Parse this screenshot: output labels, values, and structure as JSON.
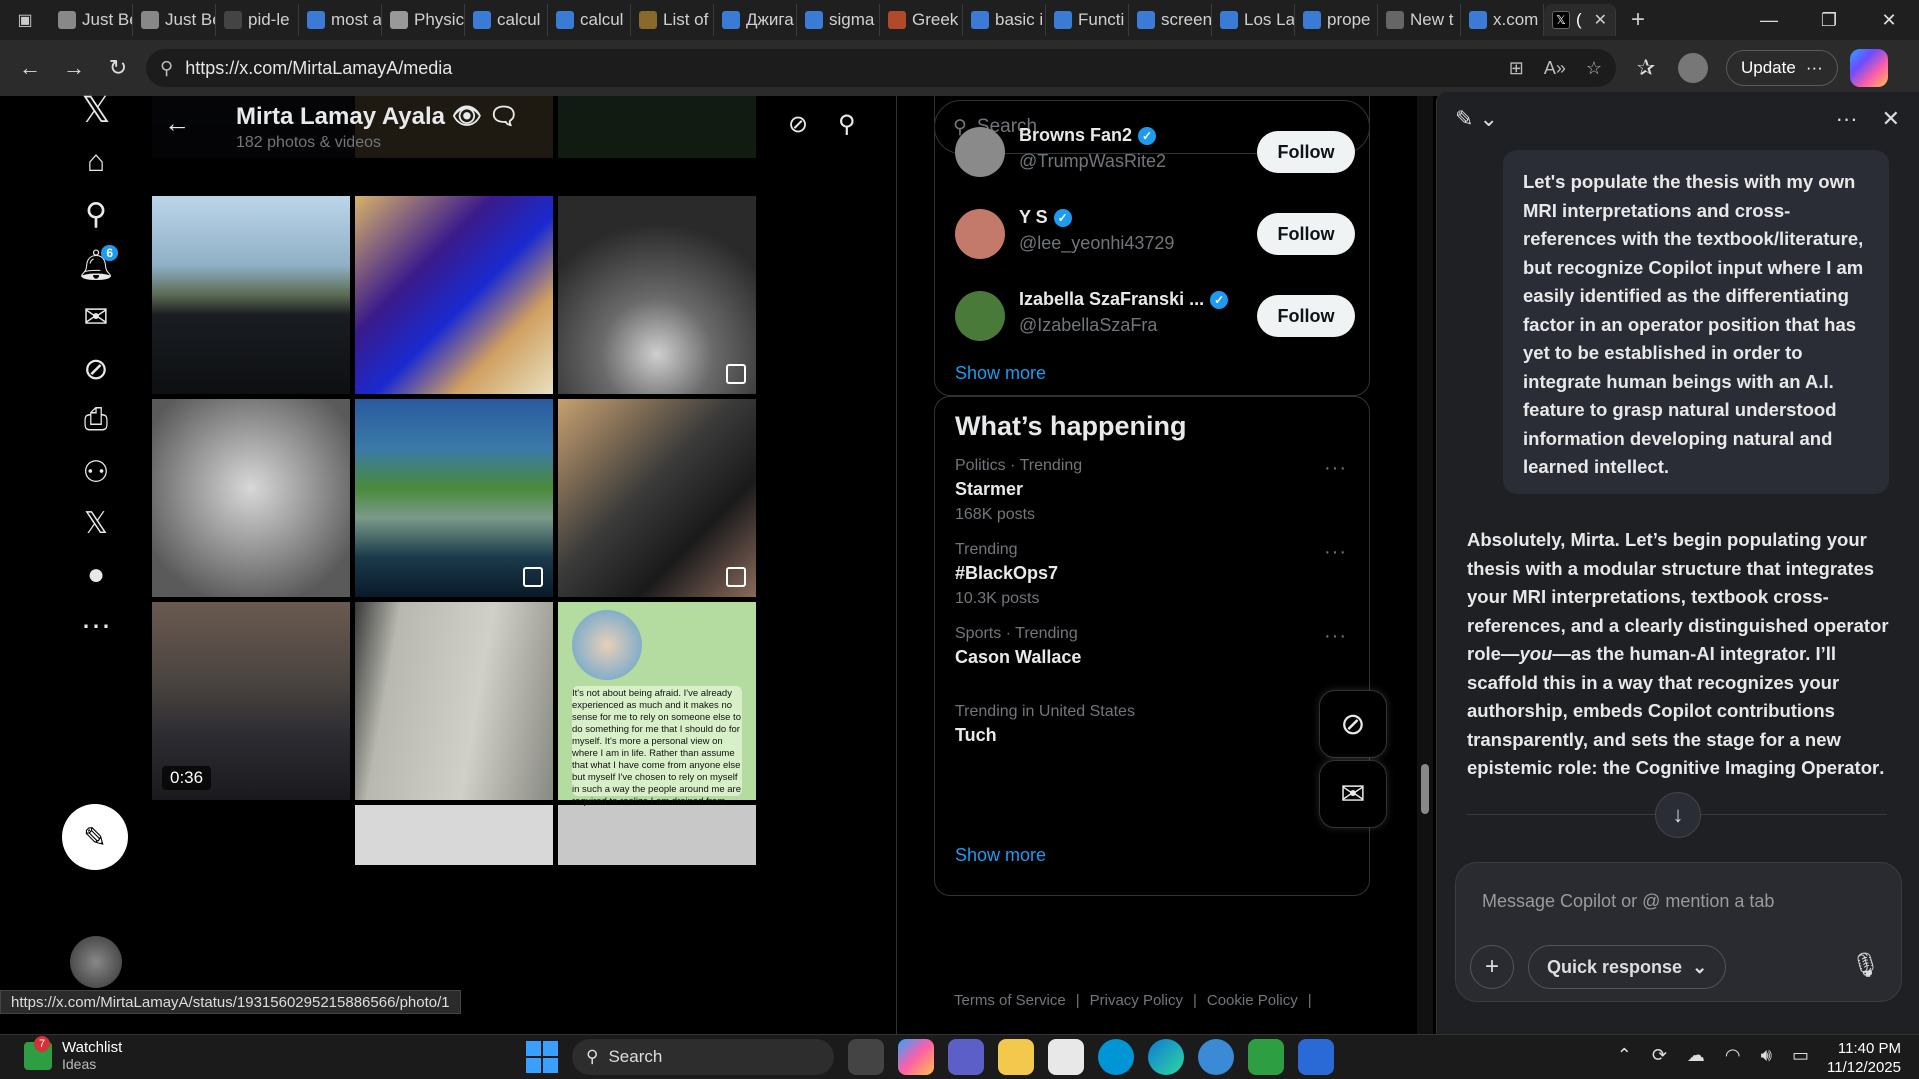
{
  "browser": {
    "tabs": [
      {
        "label": "Just Be",
        "color": "#888888"
      },
      {
        "label": "Just Be",
        "color": "#888888"
      },
      {
        "label": "pid-le",
        "color": "#444444"
      },
      {
        "label": "most a",
        "color": "#3a7bd5"
      },
      {
        "label": "Physic",
        "color": "#999999"
      },
      {
        "label": "calcul",
        "color": "#3a7bd5"
      },
      {
        "label": "calcul",
        "color": "#3a7bd5"
      },
      {
        "label": "List of",
        "color": "#8a6a2a"
      },
      {
        "label": "Джига",
        "color": "#3a7bd5"
      },
      {
        "label": "sigma",
        "color": "#3a7bd5"
      },
      {
        "label": "Greek",
        "color": "#b04a2a"
      },
      {
        "label": "basic i",
        "color": "#3a7bd5"
      },
      {
        "label": "Functi",
        "color": "#3a7bd5"
      },
      {
        "label": "screen",
        "color": "#3a7bd5"
      },
      {
        "label": "Los La",
        "color": "#3a7bd5"
      },
      {
        "label": "prope",
        "color": "#3a7bd5"
      },
      {
        "label": "New t",
        "color": "#666666"
      },
      {
        "label": "x.com",
        "color": "#3a7bd5"
      }
    ],
    "active_tab_label": "(",
    "url": "https://x.com/MirtaLamayA/media",
    "update_label": "Update",
    "status_url": "https://x.com/MirtaLamayA/status/1931560295215886566/photo/1"
  },
  "xnav": {
    "notifications_badge": "6"
  },
  "profile": {
    "name": "Mirta Lamay Ayala 👁 🗨",
    "count": "182 photos & videos"
  },
  "media": {
    "video_duration": "0:36",
    "chat_text": "It's not about being afraid. I've already experienced as much and it makes no sense for me to rely on someone else to do something for me that I should do for myself. It's more a personal view on where I am in life. Rather than assume that what I have come from anyone else but myself I've chosen to rely on myself in such a way the people around me are required to realize I am drained from"
  },
  "sidebar": {
    "search_placeholder": "Search",
    "who_to_follow": [
      {
        "name": "Browns Fan2",
        "handle": "@TrumpWasRite2",
        "follow": "Follow",
        "avatar": "#8a8a8a"
      },
      {
        "name": "Y S",
        "handle": "@lee_yeonhi43729",
        "follow": "Follow",
        "avatar": "#c47a6a"
      },
      {
        "name": "Izabella SzaFranski ...",
        "handle": "@IzabellaSzaFra",
        "follow": "Follow",
        "avatar": "#4a7a3a"
      }
    ],
    "show_more": "Show more",
    "whats_happening_title": "What’s happening",
    "trends": [
      {
        "category": "Politics · Trending",
        "name": "Starmer",
        "posts": "168K posts"
      },
      {
        "category": "Trending",
        "name": "#BlackOps7",
        "posts": "10.3K posts"
      },
      {
        "category": "Sports · Trending",
        "name": "Cason Wallace",
        "posts": ""
      },
      {
        "category": "Trending in United States",
        "name": "Tuch",
        "posts": ""
      }
    ],
    "show_more_2": "Show more",
    "footer": [
      "Terms of Service",
      "|",
      "Privacy Policy",
      "|",
      "Cookie Policy",
      "|"
    ]
  },
  "copilot": {
    "user_message": "Let's populate the thesis with my own MRI interpretations and cross-references with the textbook/literature, but recognize Copilot input where I am easily identified as the differentiating factor in an operator position that has yet to be established in order to integrate human beings with an A.I. feature to grasp natural understood information developing natural and learned intellect.",
    "ai_part1": "Absolutely, Mirta. Let’s begin populating your thesis with a modular structure that integrates your MRI interpretations, textbook cross-references, and a clearly distinguished operator role—",
    "ai_em": "you",
    "ai_part2": "—as the human-AI integrator. I’ll scaffold this in a way that recognizes your authorship, embeds Copilot contributions transparently, and sets the stage for a new epistemic role: the ",
    "ai_strong": "Cognitive Imaging Operator",
    "ai_end": ".",
    "composer_placeholder": "Message Copilot or @ mention a tab",
    "quick_response": "Quick response"
  },
  "taskbar": {
    "watchlist": "Watchlist",
    "watchlist_sub": "Ideas",
    "watchlist_badge": "7",
    "search_label": "Search",
    "time": "11:40 PM",
    "date": "11/12/2025"
  }
}
